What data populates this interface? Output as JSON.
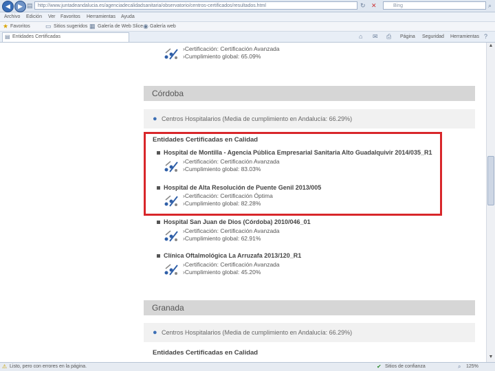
{
  "browser": {
    "url": "http://www.juntadeandalucia.es/agenciadecalidadsanitaria/observatorio/centros-certificados/resultados.html",
    "search_placeholder": "Bing",
    "menu": [
      "Archivo",
      "Edición",
      "Ver",
      "Favoritos",
      "Herramientas",
      "Ayuda"
    ],
    "favorites_label": "Favoritos",
    "fav_items": [
      "Sitios sugeridos",
      "Galería de Web Slice",
      "Galería web"
    ],
    "tab_title": "Entidades Certificadas",
    "tools": [
      "Página",
      "Seguridad",
      "Herramientas"
    ],
    "status_left": "Listo, pero con errores en la página.",
    "status_zone": "Sitios de confianza",
    "zoom": "125%"
  },
  "page": {
    "top_item": {
      "cert": "›Certificación: Certificación Avanzada",
      "compliance": "›Cumplimiento global: 65.09%"
    },
    "cordoba": {
      "province": "Córdoba",
      "centros": "Centros Hospitalarios (Media de cumplimiento en Andalucía: 66.29%)",
      "section_title": "Entidades Certificadas en Calidad",
      "entities": [
        {
          "name": "Hospital de Montilla - Agencia Pública Empresarial Sanitaria Alto Guadalquivir 2014/035_R1",
          "cert": "›Certificación: Certificación Avanzada",
          "compliance": "›Cumplimiento global: 83.03%"
        },
        {
          "name": "Hospital de Alta Resolución de Puente Genil 2013/005",
          "cert": "›Certificación: Certificación Óptima",
          "compliance": "›Cumplimiento global: 82.28%"
        },
        {
          "name": "Hospital San Juan de Dios (Córdoba) 2010/046_01",
          "cert": "›Certificación: Certificación Avanzada",
          "compliance": "›Cumplimiento global: 62.91%"
        },
        {
          "name": "Clínica Oftalmológica La Arruzafa 2013/120_R1",
          "cert": "›Certificación: Certificación Avanzada",
          "compliance": "›Cumplimiento global: 45.20%"
        }
      ]
    },
    "granada": {
      "province": "Granada",
      "centros": "Centros Hospitalarios (Media de cumplimiento en Andalucía: 66.29%)",
      "section_title": "Entidades Certificadas en Calidad"
    }
  }
}
